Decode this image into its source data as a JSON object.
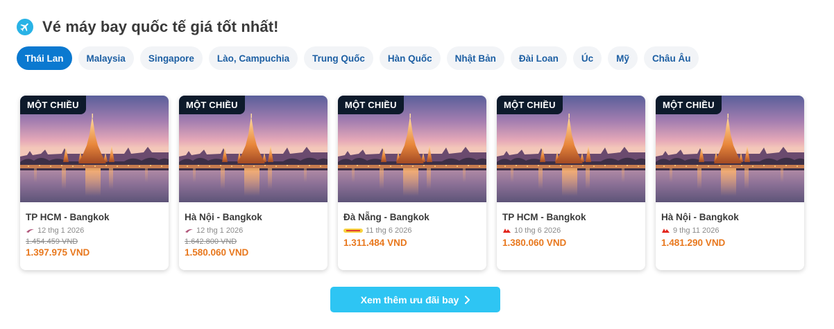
{
  "header": {
    "title": "Vé máy bay quốc tế giá tốt nhất!",
    "icon": "airplane-icon"
  },
  "tabs": [
    {
      "label": "Thái Lan",
      "active": true
    },
    {
      "label": "Malaysia",
      "active": false
    },
    {
      "label": "Singapore",
      "active": false
    },
    {
      "label": "Lào, Campuchia",
      "active": false
    },
    {
      "label": "Trung Quốc",
      "active": false
    },
    {
      "label": "Hàn Quốc",
      "active": false
    },
    {
      "label": "Nhật Bản",
      "active": false
    },
    {
      "label": "Đài Loan",
      "active": false
    },
    {
      "label": "Úc",
      "active": false
    },
    {
      "label": "Mỹ",
      "active": false
    },
    {
      "label": "Châu Âu",
      "active": false
    }
  ],
  "cards": [
    {
      "badge": "MỘT CHIỀU",
      "route": "TP HCM - Bangkok",
      "date": "12 thg 1 2026",
      "airline_icon": "thai-airways-logo-icon",
      "old_price": "1.454.459 VND",
      "price": "1.397.975 VND"
    },
    {
      "badge": "MỘT CHIỀU",
      "route": "Hà Nội - Bangkok",
      "date": "12 thg 1 2026",
      "airline_icon": "thai-airways-logo-icon",
      "old_price": "1.642.800 VND",
      "price": "1.580.060 VND"
    },
    {
      "badge": "MỘT CHIỀU",
      "route": "Đà Nẵng - Bangkok",
      "date": "11 thg 6 2026",
      "airline_icon": "vietjet-logo-icon",
      "old_price": "",
      "price": "1.311.484 VND"
    },
    {
      "badge": "MỘT CHIỀU",
      "route": "TP HCM - Bangkok",
      "date": "10 thg 6 2026",
      "airline_icon": "airasia-logo-icon",
      "old_price": "",
      "price": "1.380.060 VND"
    },
    {
      "badge": "MỘT CHIỀU",
      "route": "Hà Nội - Bangkok",
      "date": "9 thg 11 2026",
      "airline_icon": "airasia-logo-icon",
      "old_price": "",
      "price": "1.481.290 VND"
    }
  ],
  "more_button": {
    "label": "Xem thêm ưu đãi bay",
    "icon": "chevron-right-icon"
  },
  "colors": {
    "active_tab": "#0b79d0",
    "tab_text": "#1d5fa3",
    "price": "#e8781e",
    "badge_bg": "#0d1a2b",
    "button": "#2ec5f3"
  }
}
